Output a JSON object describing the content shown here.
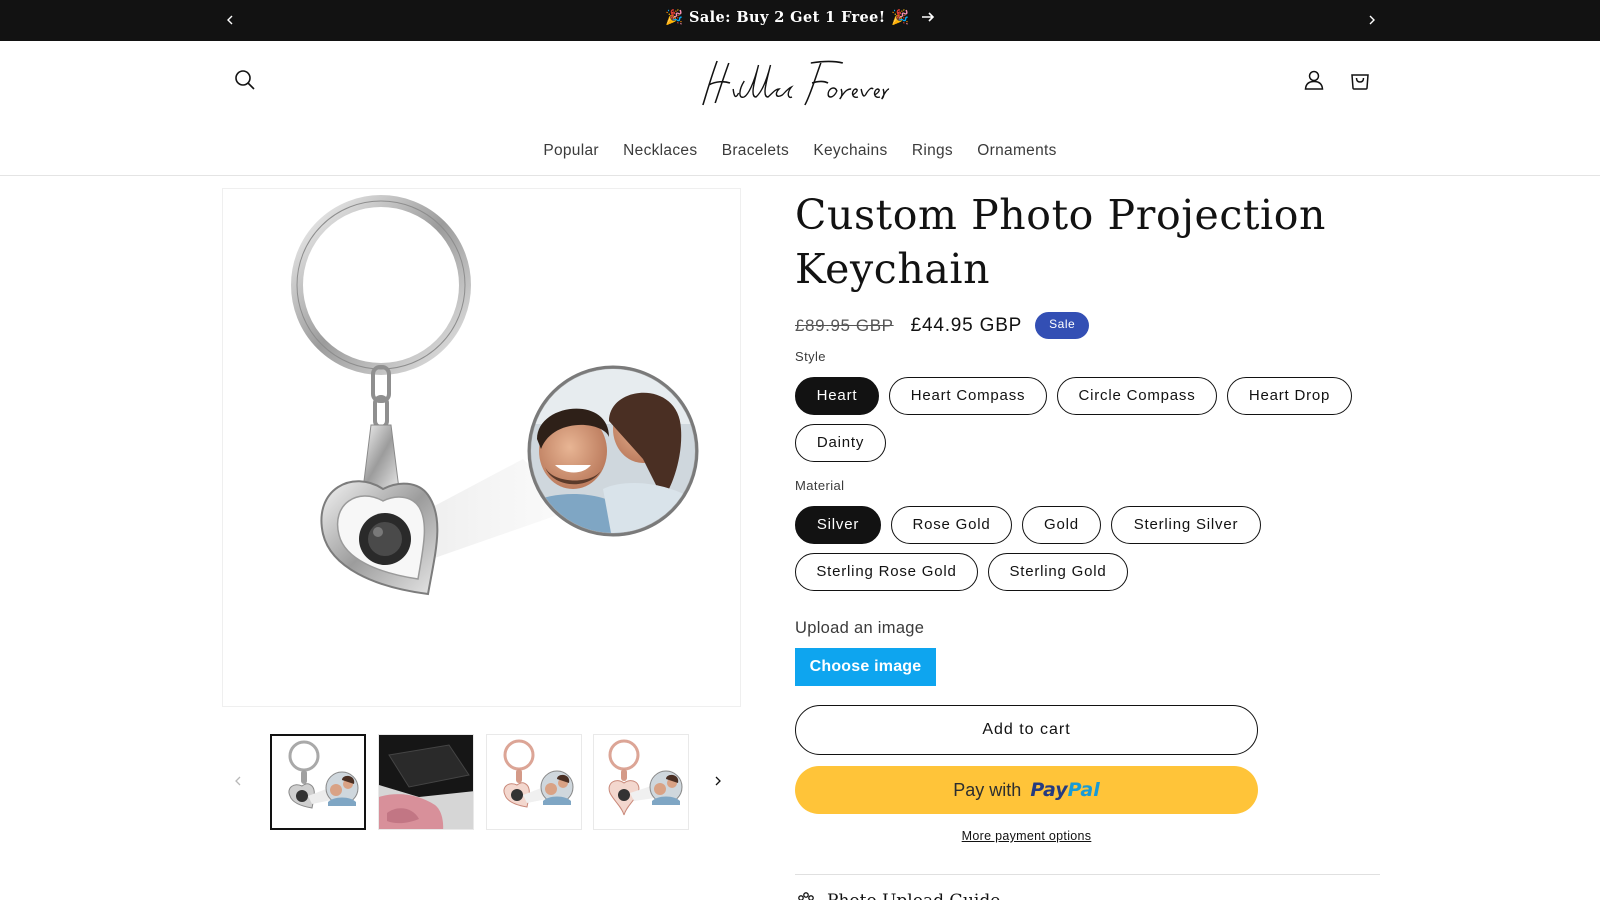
{
  "announcement": {
    "message": "🎉 Sale: Buy 2 Get 1 Free! 🎉",
    "prev_icon": "chevron-left-icon",
    "next_icon": "chevron-right-icon",
    "link_icon": "arrow-right-icon"
  },
  "header": {
    "logo_text": "Hidden Forever",
    "search_icon": "search-icon",
    "account_icon": "account-icon",
    "cart_icon": "cart-icon",
    "nav": [
      "Popular",
      "Necklaces",
      "Bracelets",
      "Keychains",
      "Rings",
      "Ornaments"
    ]
  },
  "gallery": {
    "thumbnails": [
      "heart-keychain-silver",
      "gift-box",
      "heart-keychain-rose-gold",
      "heart-drop-keychain-rose-gold"
    ],
    "active_index": 0,
    "prev_icon": "chevron-left-icon",
    "next_icon": "chevron-right-icon"
  },
  "product": {
    "title": "Custom Photo Projection Keychain",
    "price_regular": "£89.95 GBP",
    "price_sale": "£44.95 GBP",
    "badge": "Sale",
    "style_label": "Style",
    "styles": [
      "Heart",
      "Heart Compass",
      "Circle Compass",
      "Heart Drop",
      "Dainty"
    ],
    "style_selected": "Heart",
    "material_label": "Material",
    "materials": [
      "Silver",
      "Rose Gold",
      "Gold",
      "Sterling Silver",
      "Sterling Rose Gold",
      "Sterling Gold"
    ],
    "material_selected": "Silver",
    "upload_label": "Upload an image",
    "choose_button": "Choose image",
    "add_to_cart": "Add to cart",
    "paypal_prefix": "Pay with",
    "paypal_brand_1": "Pay",
    "paypal_brand_2": "Pal",
    "more_payment": "More payment options",
    "guide_title": "Photo Upload Guide"
  },
  "colors": {
    "announcement_bg": "#121212",
    "sale_badge": "#334fb4",
    "choose_button": "#0ea5ef",
    "paypal": "#ffc439"
  }
}
